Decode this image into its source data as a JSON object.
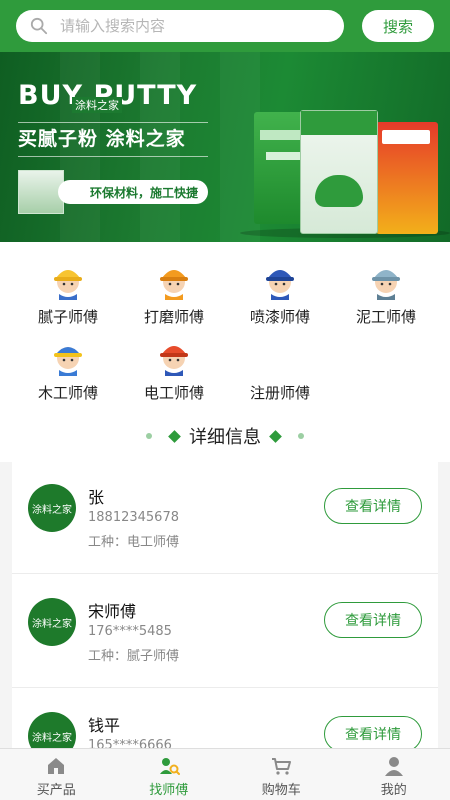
{
  "search": {
    "placeholder": "请输入搜索内容",
    "button_label": "搜索"
  },
  "banner": {
    "title": "BUY PUTTY",
    "title_small": "涂料之家",
    "slogan": "买腻子粉  涂料之家",
    "tag": "环保材料，施工快捷"
  },
  "categories": [
    {
      "label": "腻子师傅",
      "icon": "worker-yellow-helmet-icon"
    },
    {
      "label": "打磨师傅",
      "icon": "worker-orange-helmet-icon"
    },
    {
      "label": "喷漆师傅",
      "icon": "worker-blue-helmet-icon"
    },
    {
      "label": "泥工师傅",
      "icon": "worker-gray-helmet-icon"
    },
    {
      "label": "木工师傅",
      "icon": "worker-blue-cap-icon"
    },
    {
      "label": "电工师傅",
      "icon": "worker-red-helmet-icon"
    },
    {
      "label": "注册师傅",
      "icon": ""
    }
  ],
  "section": {
    "title": "详细信息"
  },
  "workers": [
    {
      "logo_text": "涂料之家",
      "name": "张",
      "phone": "18812345678",
      "job": "工种：电工师傅",
      "button": "查看详情"
    },
    {
      "logo_text": "涂料之家",
      "name": "宋师傅",
      "phone": "176****5485",
      "job": "工种：腻子师傅",
      "button": "查看详情"
    },
    {
      "logo_text": "涂料之家",
      "name": "钱平",
      "phone": "165****6666",
      "job": "",
      "button": "查看详情"
    }
  ],
  "tabs": [
    {
      "label": "买产品",
      "icon": "home-icon",
      "active": false
    },
    {
      "label": "找师傅",
      "icon": "find-worker-icon",
      "active": true
    },
    {
      "label": "购物车",
      "icon": "cart-icon",
      "active": false
    },
    {
      "label": "我的",
      "icon": "user-icon",
      "active": false
    }
  ],
  "colors": {
    "brand": "#2f9b3c",
    "text_secondary": "#888888"
  }
}
